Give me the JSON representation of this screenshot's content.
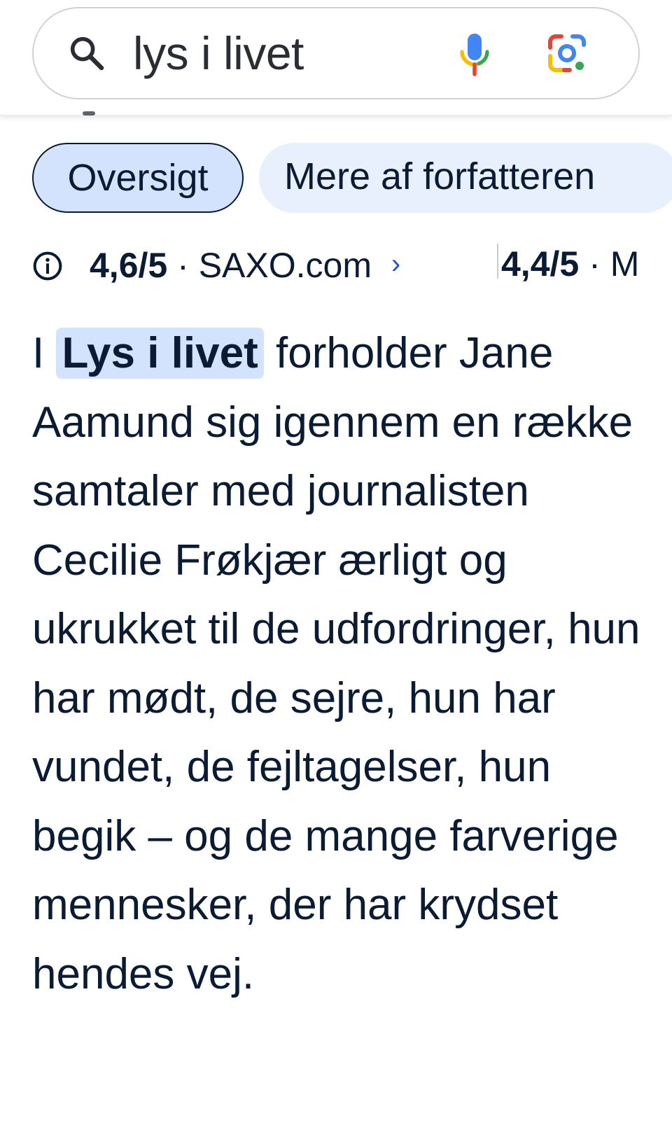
{
  "search": {
    "query": "lys i livet",
    "search_icon": "search-icon",
    "mic_icon": "microphone-icon",
    "lens_icon": "google-lens-icon"
  },
  "chips": [
    {
      "label": "Oversigt",
      "selected": true
    },
    {
      "label": "Mere af forfatteren",
      "selected": false
    }
  ],
  "ratings": [
    {
      "score": "4,6/5",
      "separator": "·",
      "source": "SAXO.com",
      "chevron": "›"
    },
    {
      "score": "4,4/5",
      "separator": "·",
      "source": "M"
    }
  ],
  "description": {
    "prefix": "I",
    "highlight": "Lys i livet",
    "body": "forholder Jane Aamund sig igennem en række samtaler med journalisten Cecilie Frøkjær ærligt og ukrukket til de udfordringer, hun har mødt, de sejre, hun har vundet, de fejltagelser, hun begik – og de mange farverige mennesker, der har krydset hendes vej."
  },
  "colors": {
    "chip_selected_bg": "#d3e3fd",
    "chip_bg": "#e8f0fe",
    "text": "#0b1b33",
    "link_chevron": "#1a57c7"
  }
}
